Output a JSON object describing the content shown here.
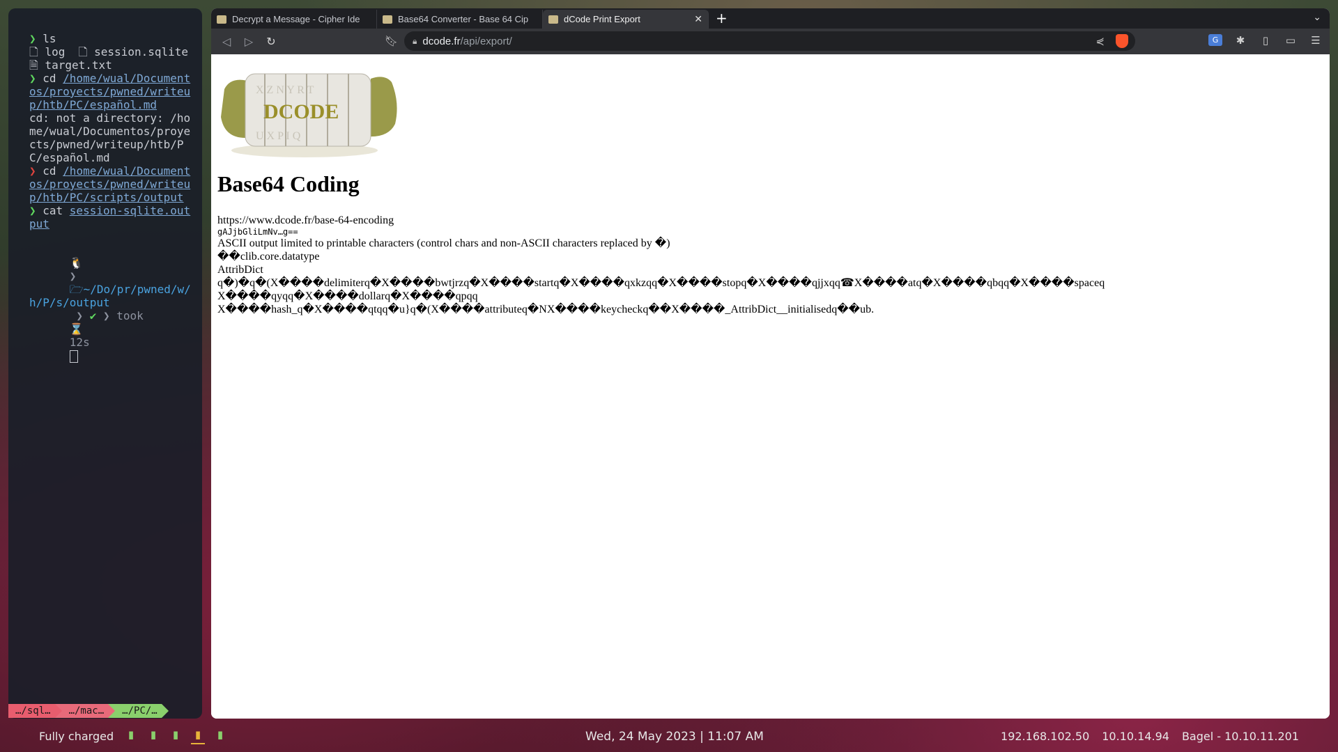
{
  "terminal": {
    "lines": [
      {
        "prefix": "❯ ",
        "prefix_type": "ok",
        "text": "ls"
      },
      {
        "prefix": "",
        "prefix_type": "none",
        "text": "🗋 log  🗋 session.sqlite  🗎 target.txt"
      },
      {
        "prefix": "❯ ",
        "prefix_type": "ok",
        "text": "cd ",
        "path": "/home/wual/Documentos/proyects/pwned/writeup/htb/PC/español.md"
      },
      {
        "prefix": "",
        "prefix_type": "none",
        "text": "cd: not a directory: /home/wual/Documentos/proyects/pwned/writeup/htb/PC/español.md"
      },
      {
        "prefix": "❯ ",
        "prefix_type": "err",
        "text": "cd ",
        "path": "/home/wual/Documentos/proyects/pwned/writeup/htb/PC/scripts/output"
      },
      {
        "prefix": "❯ ",
        "prefix_type": "ok",
        "text": "cat ",
        "path": "session-sqlite.output"
      }
    ],
    "prompt": {
      "os_icon": "🐧",
      "dir_icon": "🗁",
      "dir": "~/Do/pr/pwned/w/h/P/s/output",
      "check": "✔",
      "took_label": "took",
      "hourglass": "⌛",
      "duration": "12s"
    },
    "tmux_tabs": [
      "…/sql…",
      "…/mac…",
      "…/PC/…"
    ]
  },
  "browser": {
    "tabs": [
      {
        "title": "Decrypt a Message - Cipher Ide",
        "active": false
      },
      {
        "title": "Base64 Converter - Base 64 Cip",
        "active": false
      },
      {
        "title": "dCode Print Export",
        "active": true
      }
    ],
    "new_tab": "+",
    "url_host": "dcode.fr",
    "url_path": "/api/export/",
    "page": {
      "logo_text": "DCODE",
      "heading": "Base64 Coding",
      "source_url": "https://www.dcode.fr/base-64-encoding",
      "input_snippet": "gAJjbGliLmNv…g==",
      "note": "ASCII output limited to printable characters (control chars and non-ASCII characters replaced by �)",
      "output_lines": [
        "��clib.core.datatype",
        "AttribDict",
        "q�)�q�(X����delimiterq�X����bwtjrzq�X����startq�X����qxkzqq�X����stopq�X����qjjxqq☎X����atq�X����qbqq�X����spaceq",
        "X����qyqq�X����dollarq�X����qpqq",
        "X����hash_q�X����qtqq�u}q�(X����attributeq�NX����keycheckq��X����_AttribDict__initialisedq��ub."
      ]
    }
  },
  "statusbar": {
    "battery": "Fully charged",
    "workspaces": [
      "▮",
      "▮",
      "▮",
      "▮",
      "▮"
    ],
    "active_workspace": 3,
    "datetime": "Wed, 24 May 2023 | 11:07 AM",
    "ip_local": "192.168.102.50",
    "ip_vpn": "10.10.14.94",
    "target": "Bagel - 10.10.11.201"
  }
}
